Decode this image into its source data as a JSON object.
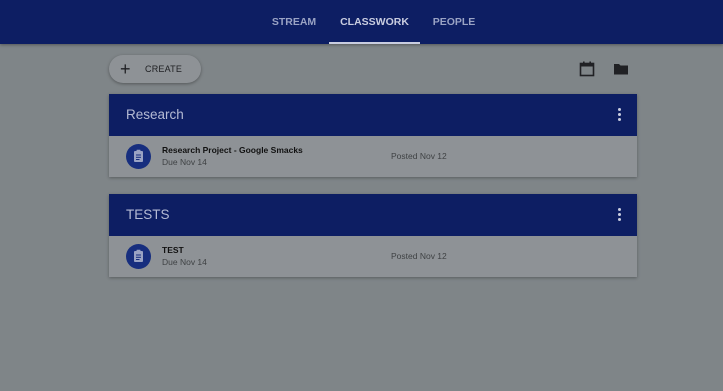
{
  "nav": {
    "tabs": [
      {
        "label": "STREAM",
        "active": false
      },
      {
        "label": "CLASSWORK",
        "active": true
      },
      {
        "label": "PEOPLE",
        "active": false
      }
    ]
  },
  "toolbar": {
    "create_label": "CREATE",
    "create_icon": "plus-icon",
    "calendar_icon": "calendar-icon",
    "folder_icon": "folder-icon"
  },
  "topics": [
    {
      "title": "Research",
      "items": [
        {
          "title": "Research Project - Google Smacks",
          "due": "Due Nov 14",
          "posted": "Posted Nov 12",
          "icon": "assignment-icon"
        }
      ]
    },
    {
      "title": "TESTS",
      "items": [
        {
          "title": "TEST",
          "due": "Due Nov 14",
          "posted": "Posted Nov 12",
          "icon": "assignment-icon"
        }
      ]
    }
  ],
  "colors": {
    "header": "#0d1e63",
    "background": "#7f8588",
    "card": "#8e9296"
  }
}
